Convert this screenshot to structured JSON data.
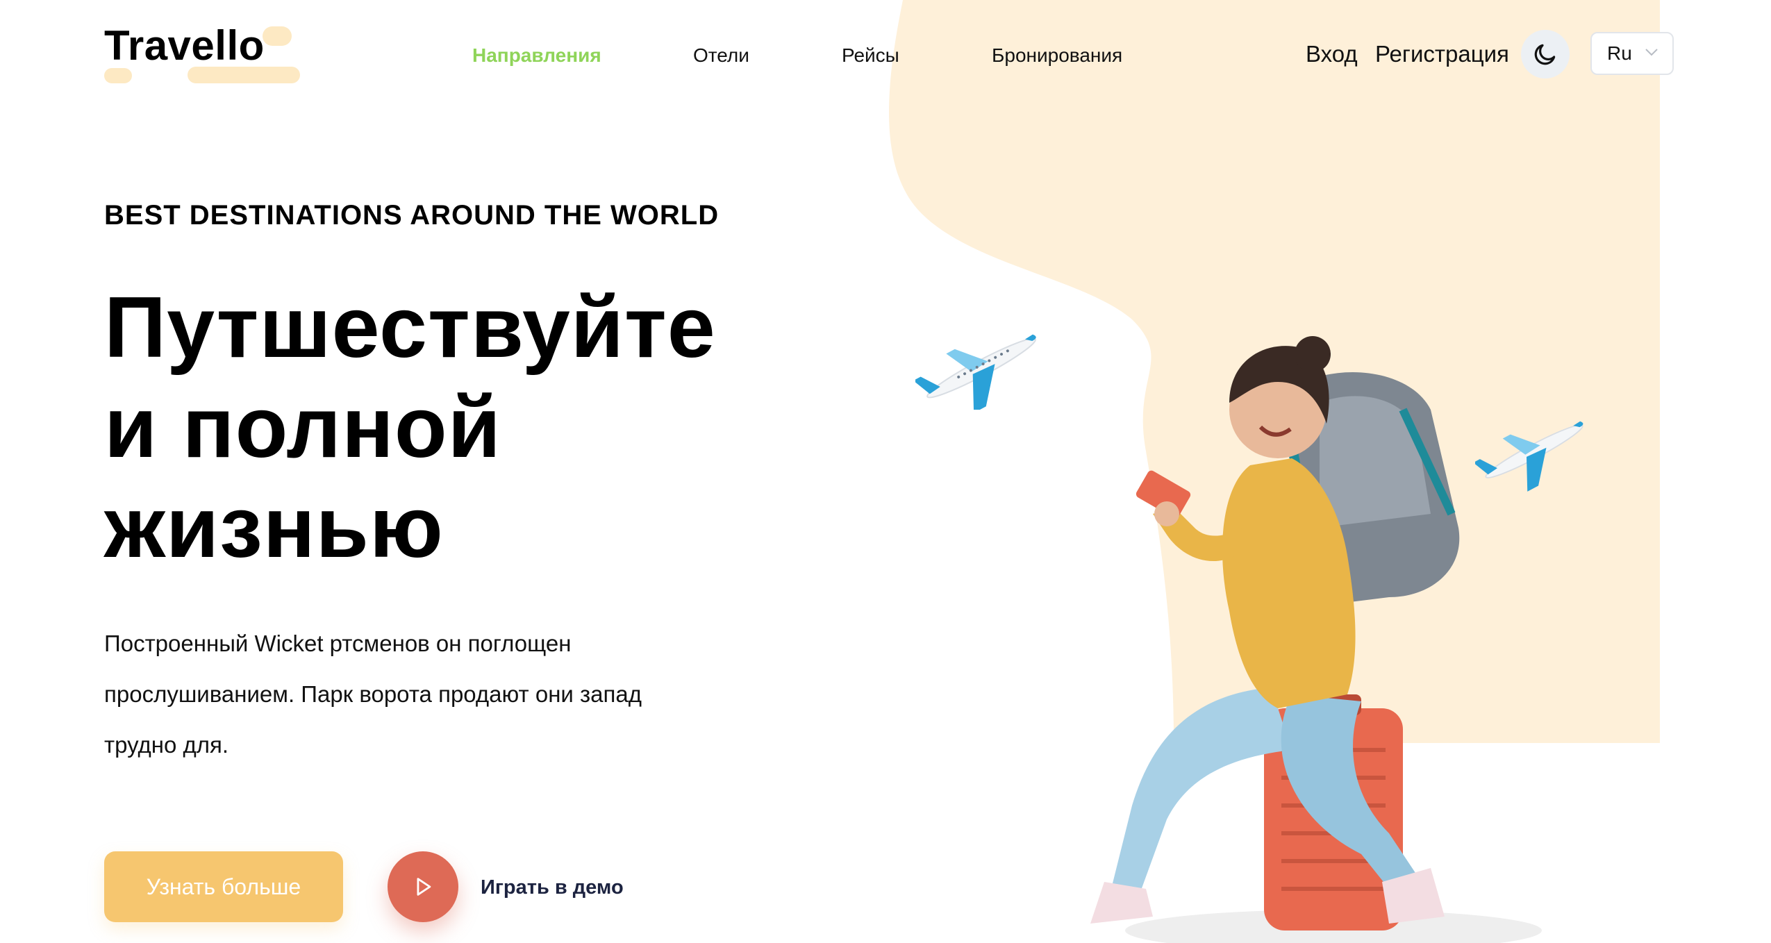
{
  "brand": {
    "logo_text": "Travello",
    "accent_color": "#8fd459",
    "blob_color": "#fef0d9",
    "cta_color": "#f6c66f",
    "play_color": "#de6a56"
  },
  "nav": {
    "items": [
      {
        "label": "Направления",
        "active": true
      },
      {
        "label": "Отели",
        "active": false
      },
      {
        "label": "Рейсы",
        "active": false
      },
      {
        "label": "Бронирования",
        "active": false
      }
    ]
  },
  "auth": {
    "login_label": "Вход",
    "register_label": "Регистрация"
  },
  "controls": {
    "theme_icon": "moon-icon",
    "language": {
      "selected": "Ru",
      "icon": "chevron-down-icon"
    }
  },
  "hero": {
    "eyebrow": "BEST DESTINATIONS AROUND THE WORLD",
    "title_lines": [
      "Путшествуйте",
      "и полной",
      "жизнью"
    ],
    "description": "Построенный Wicket ртсменов он поглощен прослушиванием. Парк ворота продают они запад трудно для.",
    "cta_label": "Узнать больше",
    "play_icon": "play-icon",
    "play_label": "Играть в демо"
  },
  "illustration": {
    "subject": "traveler-with-backpack-icon",
    "planes": [
      "airplane-icon",
      "airplane-icon"
    ]
  }
}
